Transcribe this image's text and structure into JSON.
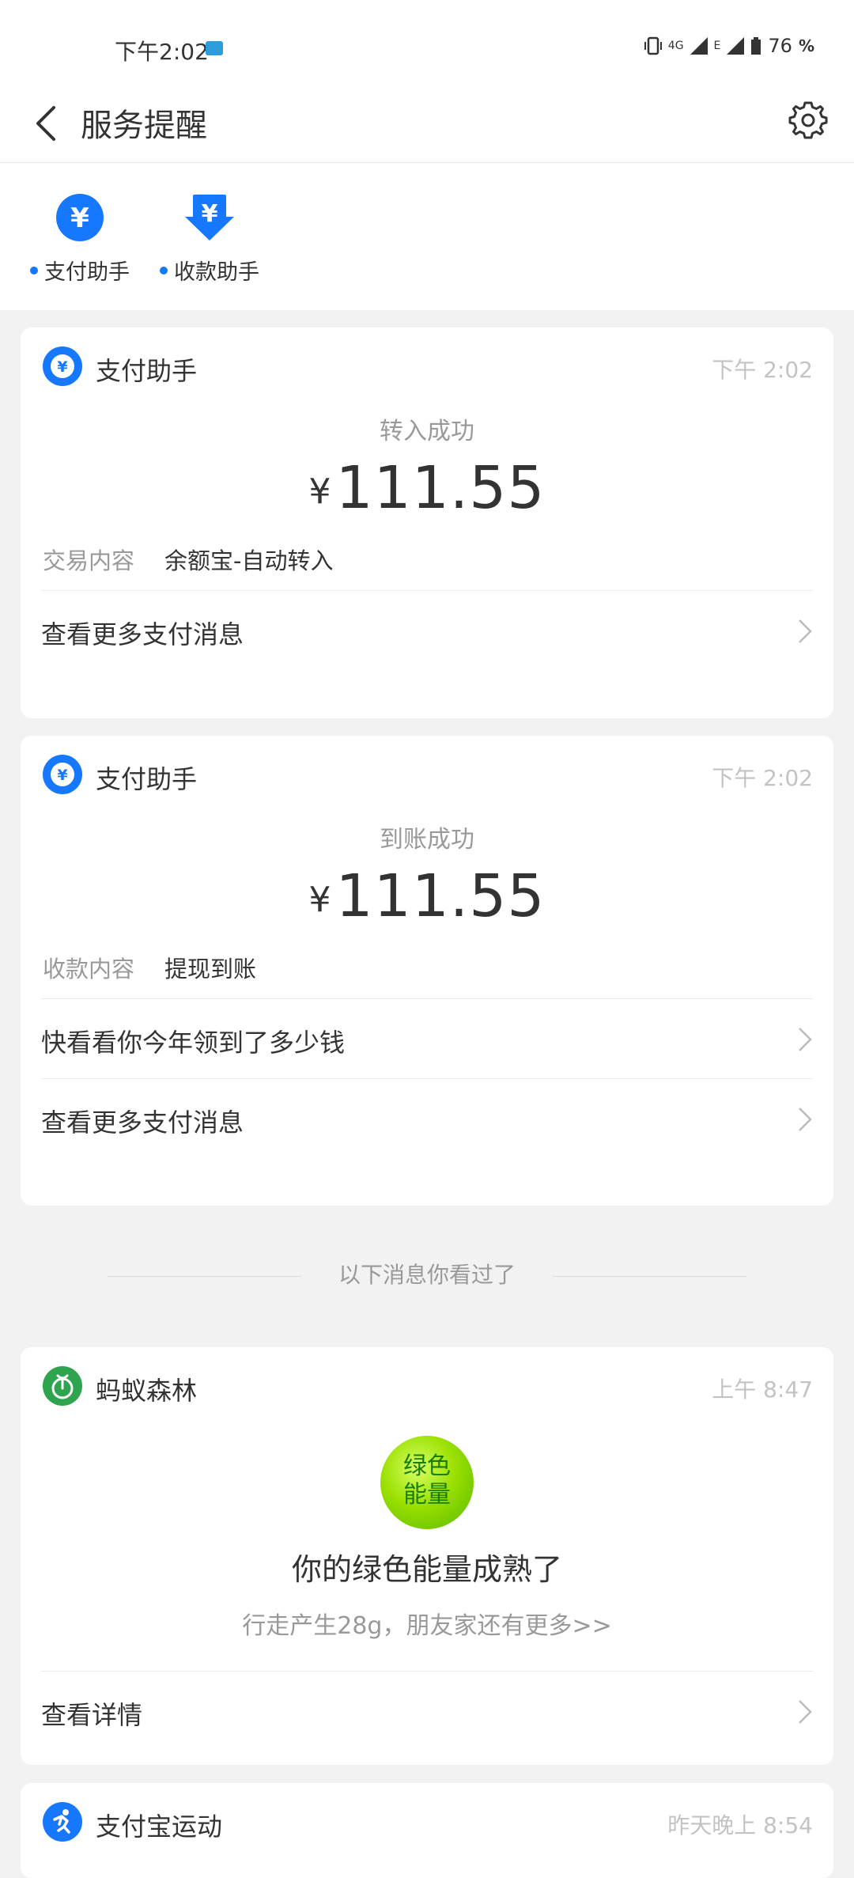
{
  "status_bar": {
    "time": "下午2:02",
    "network1": "4G",
    "network2": "E",
    "battery": "76",
    "battery_unit": "%"
  },
  "header": {
    "title": "服务提醒"
  },
  "shortcuts": [
    {
      "label": "支付助手"
    },
    {
      "label": "收款助手"
    }
  ],
  "cards": [
    {
      "sender": "支付助手",
      "time": "下午 2:02",
      "status": "转入成功",
      "currency": "¥",
      "amount": "111.55",
      "kv_key": "交易内容",
      "kv_value": "余额宝-自动转入",
      "links": [
        "查看更多支付消息"
      ]
    },
    {
      "sender": "支付助手",
      "time": "下午 2:02",
      "status": "到账成功",
      "currency": "¥",
      "amount": "111.55",
      "kv_key": "收款内容",
      "kv_value": "提现到账",
      "links": [
        "快看看你今年领到了多少钱",
        "查看更多支付消息"
      ]
    }
  ],
  "divider": "以下消息你看过了",
  "forest_card": {
    "sender": "蚂蚁森林",
    "time": "上午 8:47",
    "ball_line1": "绿色",
    "ball_line2": "能量",
    "title": "你的绿色能量成熟了",
    "subtitle": "行走产生28g，朋友家还有更多>>",
    "link": "查看详情"
  },
  "sport_card": {
    "sender": "支付宝运动",
    "time": "昨天晚上 8:54"
  },
  "colors": {
    "accent": "#1677ff",
    "forest_green": "#2ea44f"
  }
}
